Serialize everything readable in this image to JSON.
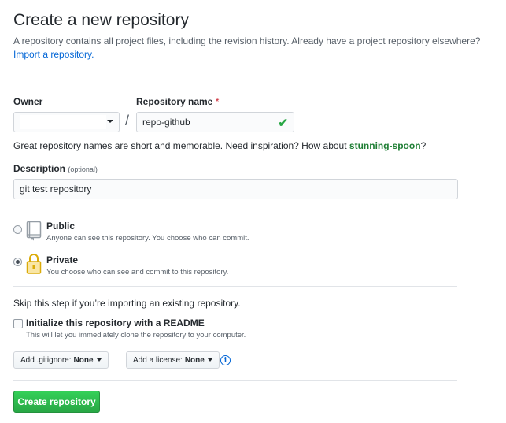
{
  "header": {
    "title": "Create a new repository",
    "description": "A repository contains all project files, including the revision history. Already have a project repository elsewhere?",
    "import_link": "Import a repository."
  },
  "owner": {
    "label": "Owner",
    "value": ""
  },
  "repo_name": {
    "label": "Repository name",
    "required_mark": "*",
    "value": "repo-github",
    "valid_icon": "check-icon"
  },
  "hint": {
    "text": "Great repository names are short and memorable. Need inspiration? How about",
    "suggestion": "stunning-spoon",
    "suffix": "?"
  },
  "description": {
    "label": "Description",
    "optional": "(optional)",
    "value": "git test repository"
  },
  "visibility": {
    "public": {
      "title": "Public",
      "desc": "Anyone can see this repository. You choose who can commit.",
      "icon": "repo-book-icon",
      "selected": false
    },
    "private": {
      "title": "Private",
      "desc": "You choose who can see and commit to this repository.",
      "icon": "lock-icon",
      "selected": true
    }
  },
  "init": {
    "skip_text": "Skip this step if you’re importing an existing repository.",
    "readme_label": "Initialize this repository with a README",
    "readme_desc": "This will let you immediately clone the repository to your computer.",
    "readme_checked": false
  },
  "gitignore": {
    "prefix": "Add .gitignore:",
    "value": "None"
  },
  "license": {
    "prefix": "Add a license:",
    "value": "None"
  },
  "submit": {
    "label": "Create repository"
  },
  "colors": {
    "primary_green": "#28a745",
    "link_blue": "#0366d6",
    "required_red": "#cb2431",
    "suggestion_green": "#1e7e34"
  }
}
